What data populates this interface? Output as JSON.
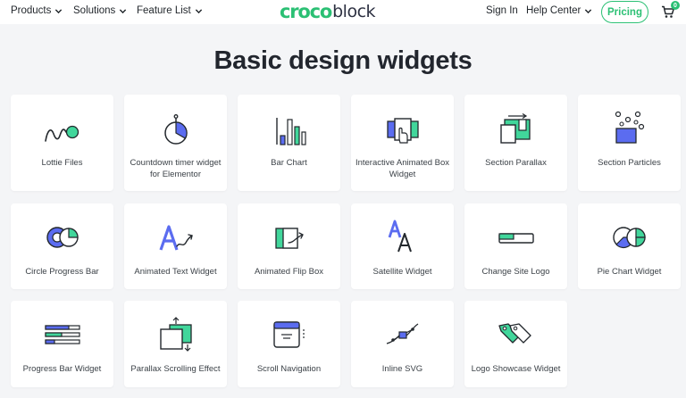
{
  "nav": {
    "products": "Products",
    "solutions": "Solutions",
    "feature_list": "Feature List",
    "logo_croco": "croco",
    "logo_block": "block",
    "sign_in": "Sign In",
    "help_center": "Help Center",
    "pricing": "Pricing",
    "cart_count": "0"
  },
  "page": {
    "title": "Basic design widgets"
  },
  "colors": {
    "accent": "#2bc074",
    "icon_blue": "#5b6cf0",
    "icon_green": "#41d69b",
    "icon_stroke": "#23282d",
    "background": "#f4f5f7"
  },
  "widgets": [
    {
      "label": "Lottie Files",
      "icon": "lottie-icon"
    },
    {
      "label": "Countdown timer widget for Elementor",
      "icon": "countdown-timer-icon"
    },
    {
      "label": "Bar Chart",
      "icon": "bar-chart-icon"
    },
    {
      "label": "Interactive Animated Box Widget",
      "icon": "animated-box-icon"
    },
    {
      "label": "Section Parallax",
      "icon": "section-parallax-icon"
    },
    {
      "label": "Section Particles",
      "icon": "section-particles-icon"
    },
    {
      "label": "Circle Progress Bar",
      "icon": "circle-progress-icon"
    },
    {
      "label": "Animated Text Widget",
      "icon": "animated-text-icon"
    },
    {
      "label": "Animated Flip Box",
      "icon": "flip-box-icon"
    },
    {
      "label": "Satellite Widget",
      "icon": "satellite-icon"
    },
    {
      "label": "Change Site Logo",
      "icon": "change-logo-icon"
    },
    {
      "label": "Pie Chart Widget",
      "icon": "pie-chart-icon"
    },
    {
      "label": "Progress Bar Widget",
      "icon": "progress-bar-icon"
    },
    {
      "label": "Parallax Scrolling Effect",
      "icon": "parallax-scrolling-icon"
    },
    {
      "label": "Scroll Navigation",
      "icon": "scroll-navigation-icon"
    },
    {
      "label": "Inline SVG",
      "icon": "inline-svg-icon"
    },
    {
      "label": "Logo Showcase Widget",
      "icon": "logo-showcase-icon"
    }
  ]
}
